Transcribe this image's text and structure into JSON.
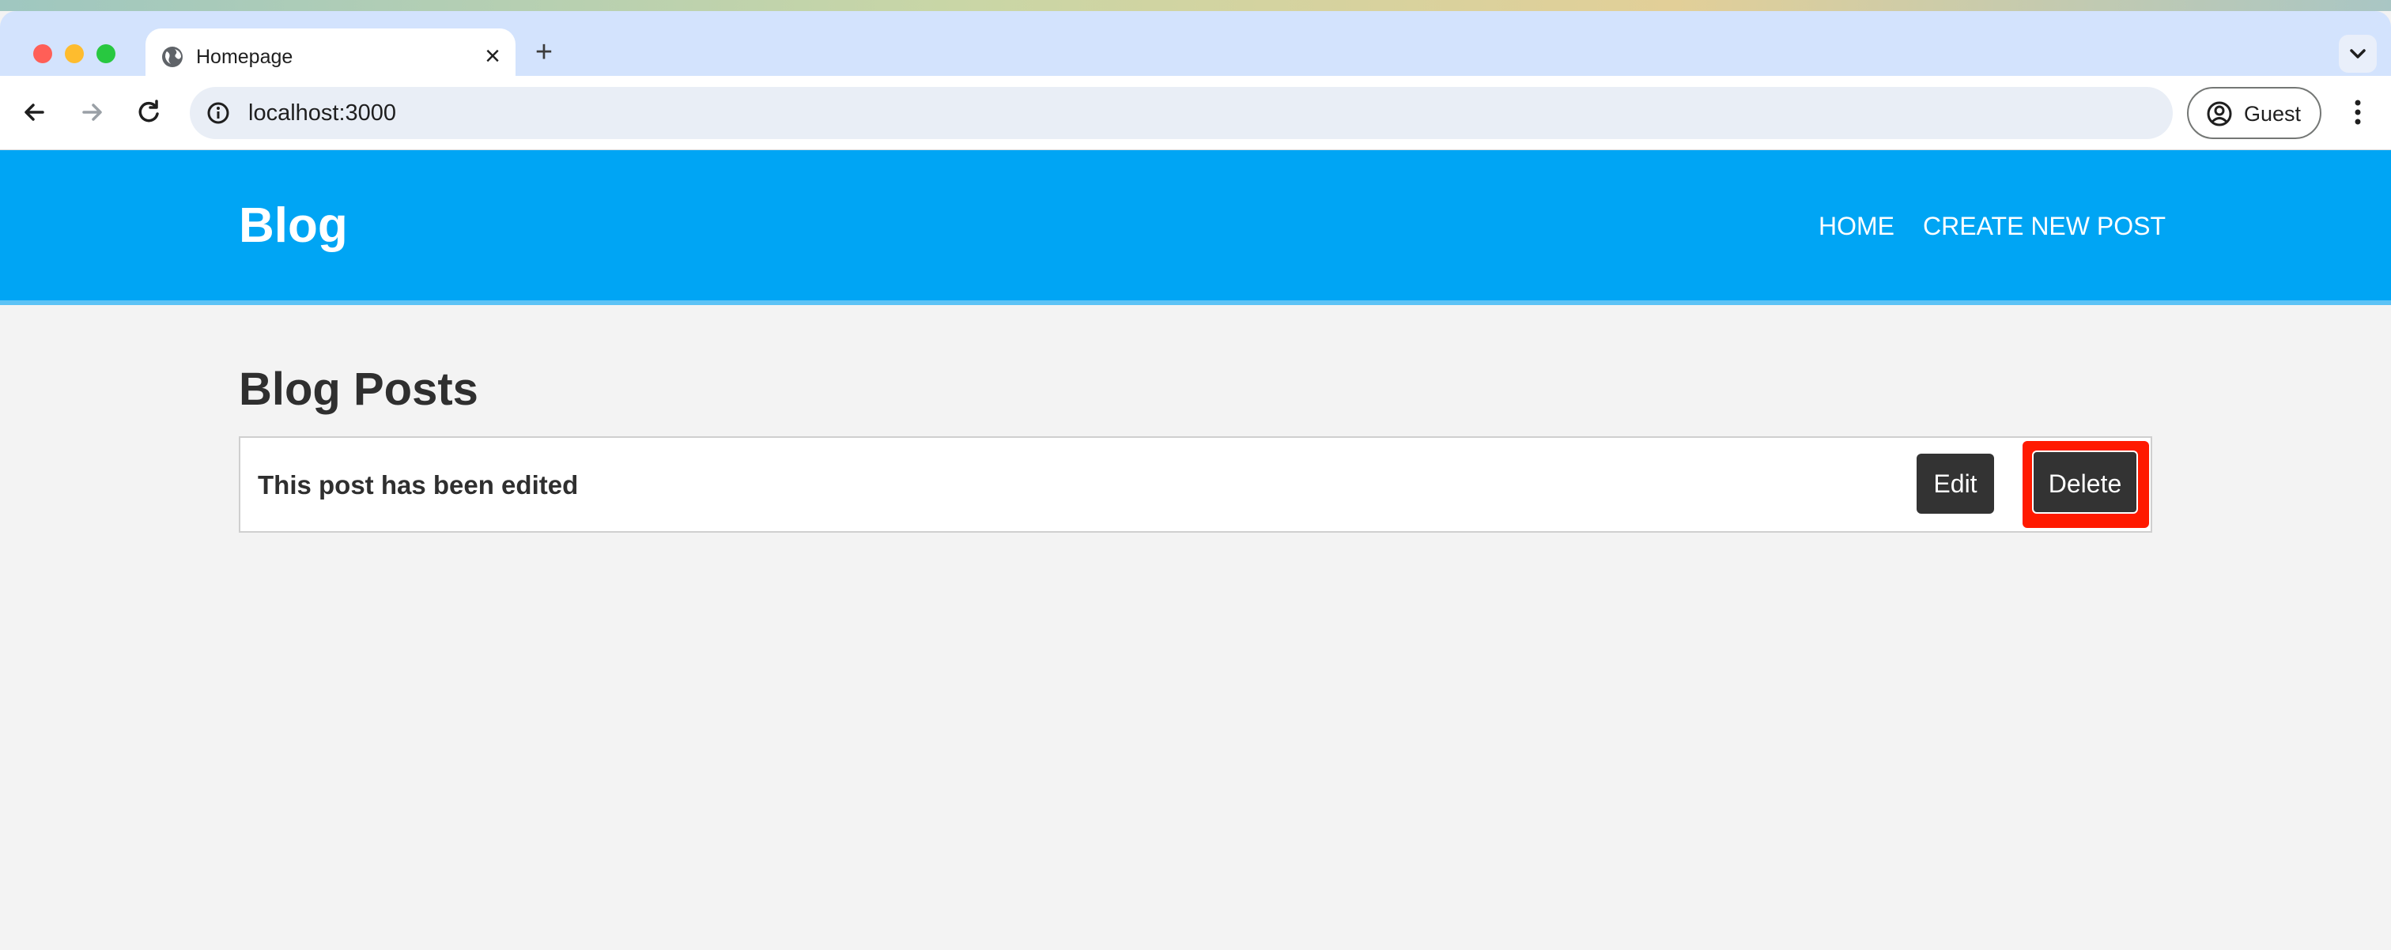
{
  "browser": {
    "tab_title": "Homepage",
    "new_tab_glyph": "+",
    "close_glyph": "×",
    "url": "localhost:3000",
    "profile_label": "Guest"
  },
  "site": {
    "logo": "Blog",
    "nav": {
      "home": "HOME",
      "create": "CREATE NEW POST"
    },
    "header_color": "#00a5f4"
  },
  "main": {
    "title": "Blog Posts",
    "posts": [
      {
        "title": "This post has been edited",
        "edit_label": "Edit",
        "delete_label": "Delete"
      }
    ]
  },
  "highlight_color": "#ff1a00"
}
